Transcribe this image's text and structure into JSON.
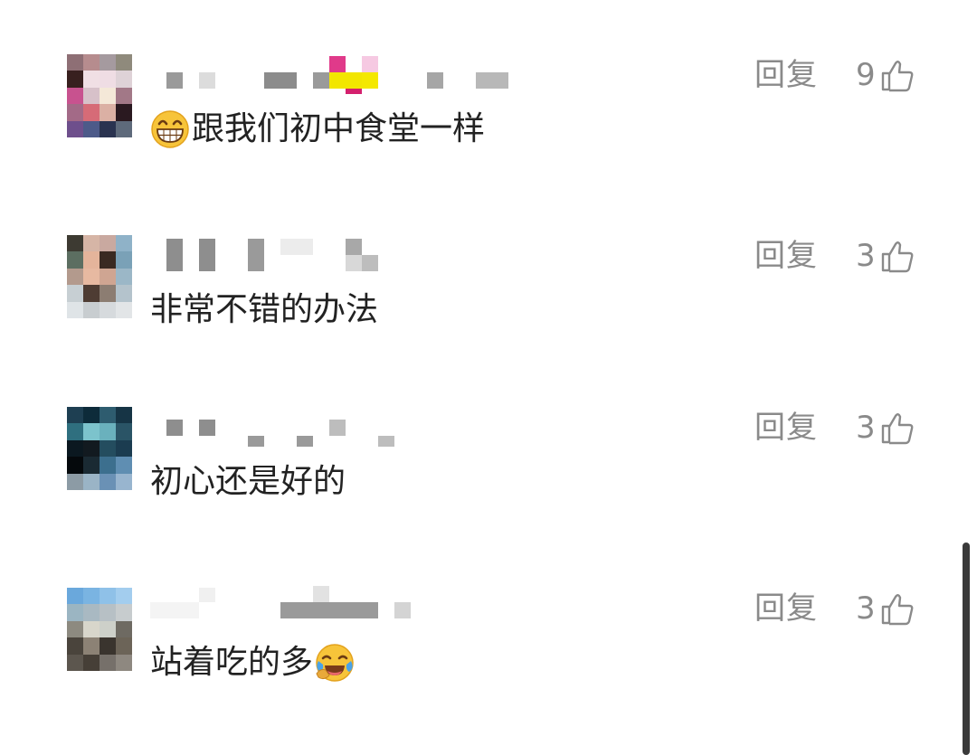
{
  "comments": [
    {
      "text": "跟我们初中食堂一样",
      "reply_label": "回复",
      "like_count": "9",
      "emoji": "grinning-face-with-smiling-eyes",
      "emoji_position": "before",
      "avatar_colors": [
        "#8e6f75",
        "#b68c8e",
        "#a59a9f",
        "#8f8a7c",
        "#38201f",
        "#f0dfe4",
        "#efdde4",
        "#ded2d7",
        "#c8528f",
        "#d7c1c9",
        "#f4e8d8",
        "#a27887",
        "#a36a87",
        "#d66b77",
        "#dbb0a4",
        "#2a1920",
        "#6e4f8c",
        "#4d5a89",
        "#2a3350",
        "#5e6a7b"
      ]
    },
    {
      "text": "非常不错的办法",
      "reply_label": "回复",
      "like_count": "3",
      "emoji": "",
      "emoji_position": "",
      "avatar_colors": [
        "#3d3a32",
        "#d6b5a6",
        "#c9a9a0",
        "#8fb2c8",
        "#5c6e61",
        "#e4b49b",
        "#3a2a22",
        "#7aa1b7",
        "#b39a8d",
        "#e7b9a1",
        "#cfa592",
        "#9bb7c7",
        "#c7cfd3",
        "#4e3c33",
        "#8c7d72",
        "#b4c3cc",
        "#dfe4e7",
        "#c8cdd0",
        "#d6dadd",
        "#e2e5e7"
      ]
    },
    {
      "text": "初心还是好的",
      "reply_label": "回复",
      "like_count": "3",
      "emoji": "",
      "emoji_position": "",
      "avatar_colors": [
        "#1e3f52",
        "#0d2b3a",
        "#2e5c6f",
        "#163445",
        "#2f6f7f",
        "#7cc3cc",
        "#6ab1bd",
        "#2a5466",
        "#0b1820",
        "#121a20",
        "#244d5f",
        "#1b3c50",
        "#05090c",
        "#1a2a33",
        "#3c6f8e",
        "#5f8eb2",
        "#8c9ba5",
        "#9ab4c6",
        "#6a91b5",
        "#98b5cf"
      ]
    },
    {
      "text": "站着吃的多",
      "reply_label": "回复",
      "like_count": "3",
      "emoji": "face-with-tears-of-joy",
      "emoji_position": "after",
      "avatar_colors": [
        "#6aa8dc",
        "#7ab4e2",
        "#8fc1e8",
        "#a3cdee",
        "#9bb5c2",
        "#a9b9c2",
        "#b7c0c5",
        "#c7ccce",
        "#8d8a80",
        "#d8d6cb",
        "#cdd0c9",
        "#6e6a62",
        "#4a443c",
        "#8c8275",
        "#3a342e",
        "#6c6458",
        "#5c564e",
        "#463f37",
        "#76706a",
        "#8e8880"
      ]
    }
  ],
  "icons": {
    "like": "thumbs-up-outline-icon"
  },
  "colors": {
    "text": "#222222",
    "meta": "#8a8a8a",
    "background": "#ffffff"
  }
}
